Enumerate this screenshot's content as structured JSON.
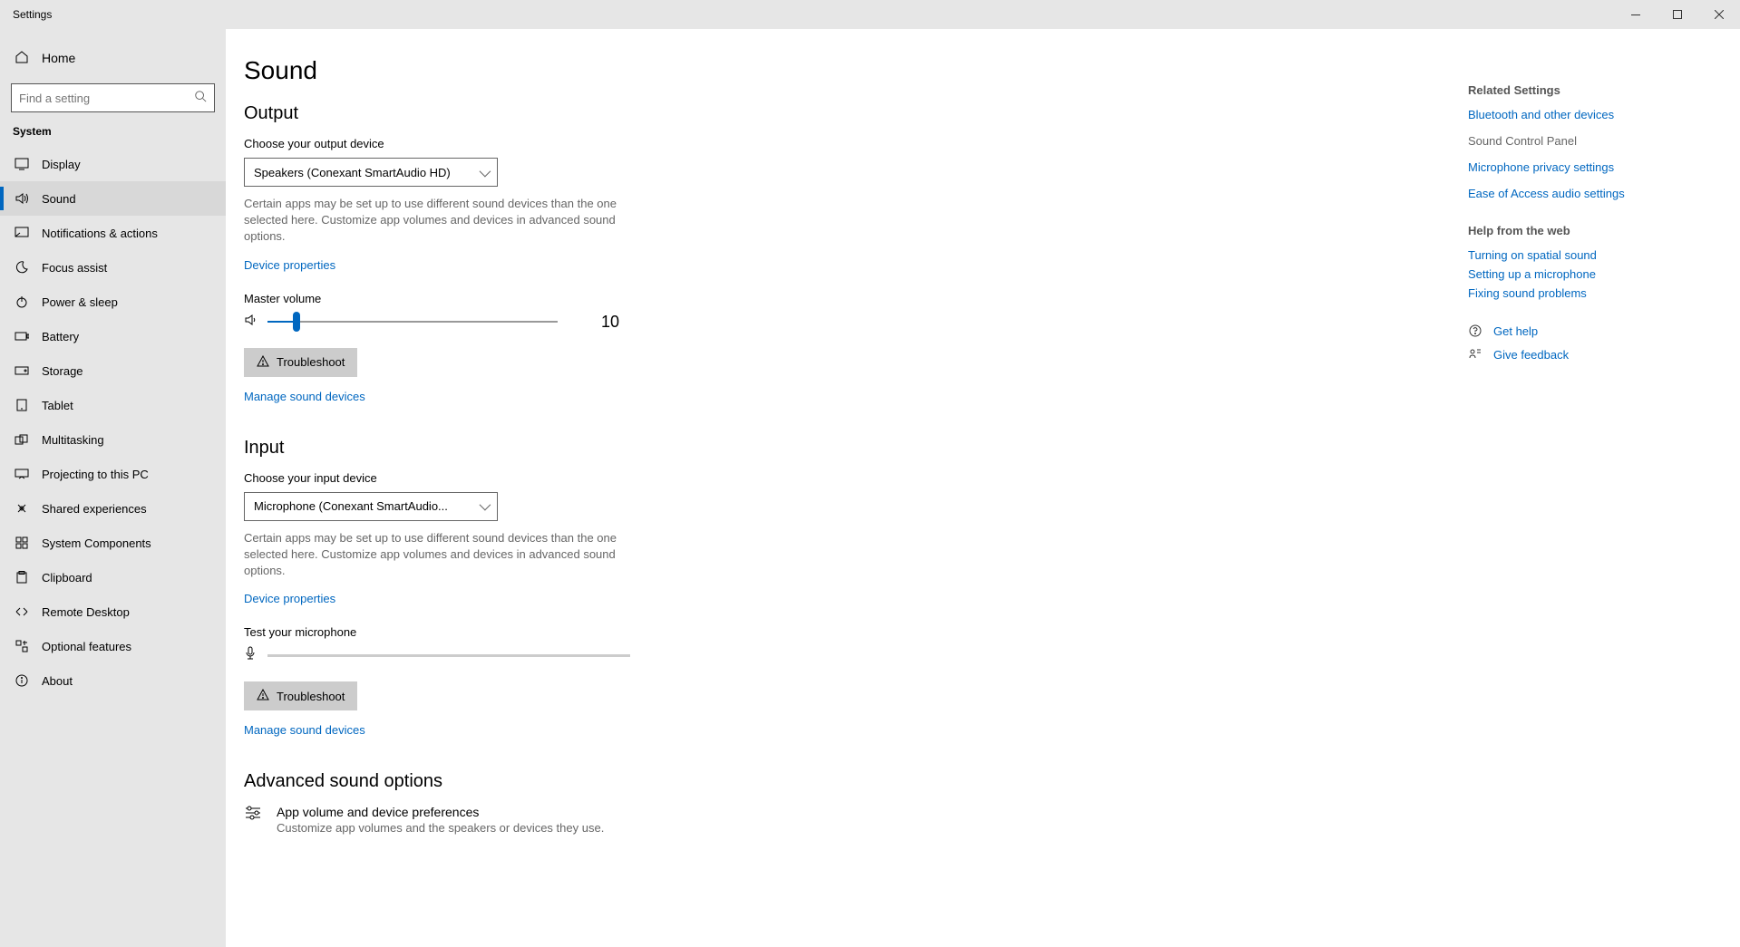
{
  "window": {
    "title": "Settings"
  },
  "sidebar": {
    "home": "Home",
    "search_placeholder": "Find a setting",
    "category": "System",
    "items": [
      {
        "label": "Display"
      },
      {
        "label": "Sound"
      },
      {
        "label": "Notifications & actions"
      },
      {
        "label": "Focus assist"
      },
      {
        "label": "Power & sleep"
      },
      {
        "label": "Battery"
      },
      {
        "label": "Storage"
      },
      {
        "label": "Tablet"
      },
      {
        "label": "Multitasking"
      },
      {
        "label": "Projecting to this PC"
      },
      {
        "label": "Shared experiences"
      },
      {
        "label": "System Components"
      },
      {
        "label": "Clipboard"
      },
      {
        "label": "Remote Desktop"
      },
      {
        "label": "Optional features"
      },
      {
        "label": "About"
      }
    ]
  },
  "page": {
    "title": "Sound",
    "output": {
      "heading": "Output",
      "choose_label": "Choose your output device",
      "selected": "Speakers (Conexant SmartAudio HD)",
      "desc": "Certain apps may be set up to use different sound devices than the one selected here. Customize app volumes and devices in advanced sound options.",
      "device_properties": "Device properties",
      "master_volume_label": "Master volume",
      "master_volume_value": "10",
      "troubleshoot": "Troubleshoot",
      "manage": "Manage sound devices"
    },
    "input": {
      "heading": "Input",
      "choose_label": "Choose your input device",
      "selected": "Microphone (Conexant SmartAudio...",
      "desc": "Certain apps may be set up to use different sound devices than the one selected here. Customize app volumes and devices in advanced sound options.",
      "device_properties": "Device properties",
      "test_label": "Test your microphone",
      "troubleshoot": "Troubleshoot",
      "manage": "Manage sound devices"
    },
    "advanced": {
      "heading": "Advanced sound options",
      "item_title": "App volume and device preferences",
      "item_sub": "Customize app volumes and the speakers or devices they use."
    }
  },
  "related": {
    "heading": "Related Settings",
    "links": [
      {
        "label": "Bluetooth and other devices",
        "muted": false
      },
      {
        "label": "Sound Control Panel",
        "muted": true
      },
      {
        "label": "Microphone privacy settings",
        "muted": false
      },
      {
        "label": "Ease of Access audio settings",
        "muted": false
      }
    ],
    "help_heading": "Help from the web",
    "help_links": [
      "Turning on spatial sound",
      "Setting up a microphone",
      "Fixing sound problems"
    ],
    "get_help": "Get help",
    "give_feedback": "Give feedback"
  }
}
